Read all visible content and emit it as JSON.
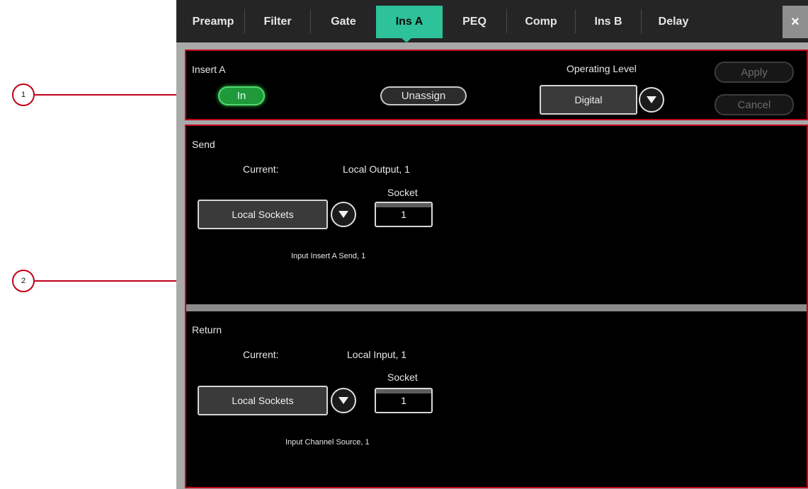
{
  "callouts": [
    "1",
    "2"
  ],
  "tabs": [
    {
      "label": "Preamp"
    },
    {
      "label": "Filter"
    },
    {
      "label": "Gate"
    },
    {
      "label": "Ins A"
    },
    {
      "label": "PEQ"
    },
    {
      "label": "Comp"
    },
    {
      "label": "Ins B"
    },
    {
      "label": "Delay"
    }
  ],
  "active_tab": "Ins A",
  "close_label": "×",
  "insert": {
    "title": "Insert A",
    "in_button": "In",
    "unassign_button": "Unassign",
    "operating_level_label": "Operating Level",
    "operating_level_value": "Digital",
    "apply_button": "Apply",
    "cancel_button": "Cancel"
  },
  "send": {
    "title": "Send",
    "current_label": "Current:",
    "current_value": "Local Output, 1",
    "source_value": "Local Sockets",
    "socket_label": "Socket",
    "socket_value": "1",
    "description": "Input Insert A Send, 1"
  },
  "return": {
    "title": "Return",
    "current_label": "Current:",
    "current_value": "Local Input, 1",
    "source_value": "Local Sockets",
    "socket_label": "Socket",
    "socket_value": "1",
    "description": "Input Channel Source, 1"
  },
  "colors": {
    "active_tab": "#2ec29a",
    "in_button": "#1f9a3a",
    "callout_red": "#c00018"
  }
}
